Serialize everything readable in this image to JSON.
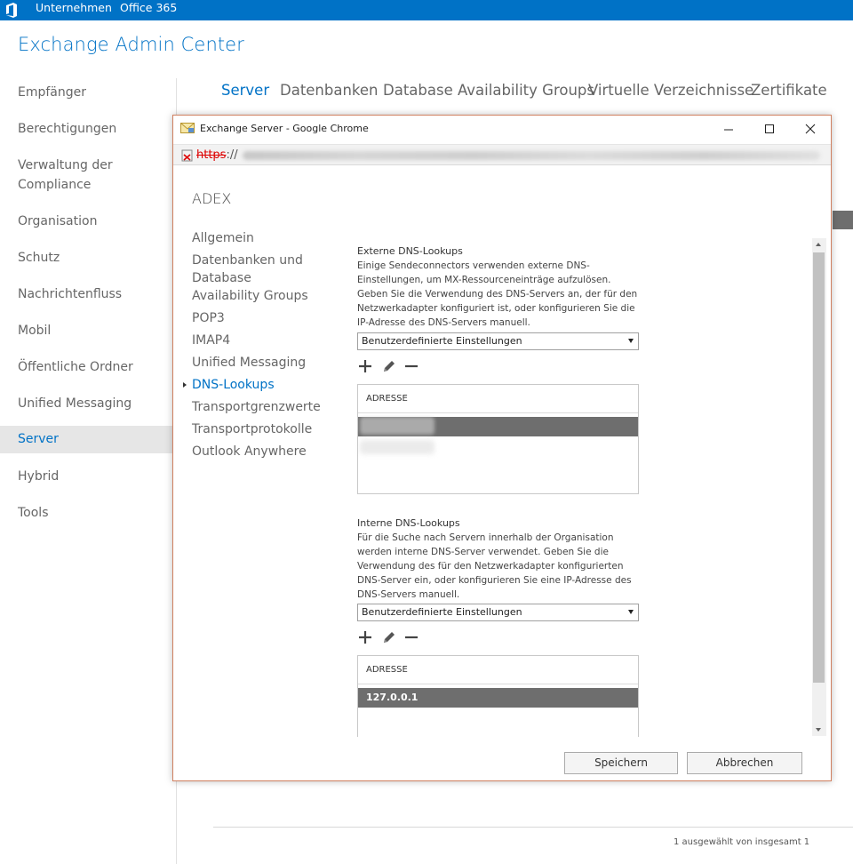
{
  "topbar": {
    "links": [
      "Unternehmen",
      "Office 365"
    ]
  },
  "app": {
    "title": "Exchange Admin Center"
  },
  "leftnav": {
    "items": [
      "Empfänger",
      "Berechtigungen",
      "Verwaltung der Compliance",
      "Organisation",
      "Schutz",
      "Nachrichtenfluss",
      "Mobil",
      "Öffentliche Ordner",
      "Unified Messaging",
      "Server",
      "Hybrid",
      "Tools"
    ],
    "selected": "Server"
  },
  "tabs": {
    "items": [
      "Server",
      "Datenbanken",
      "Database Availability Groups",
      "Virtuelle Verzeichnisse",
      "Zertifikate"
    ],
    "selected": "Server"
  },
  "status": {
    "text": "1 ausgewählt von insgesamt 1"
  },
  "popup": {
    "window_title": "Exchange Server - Google Chrome",
    "url_scheme": "https",
    "url_separator": "://",
    "heading": "ADEX",
    "nav": [
      "Allgemein",
      "Datenbanken und Database Availability Groups",
      "POP3",
      "IMAP4",
      "Unified Messaging",
      "DNS-Lookups",
      "Transportgrenzwerte",
      "Transportprotokolle",
      "Outlook Anywhere"
    ],
    "nav_selected": "DNS-Lookups",
    "external": {
      "title": "Externe DNS-Lookups",
      "description": "Einige Sendeconnectors verwenden externe DNS-Einstellungen, um MX-Ressourceneinträge aufzulösen. Geben Sie die Verwendung des DNS-Servers an, der für den Netzwerkadapter konfiguriert ist, oder konfigurieren Sie die IP-Adresse des DNS-Servers manuell.",
      "dropdown_value": "Benutzerdefinierte Einstellungen",
      "column_header": "ADRESSE"
    },
    "internal": {
      "title": "Interne DNS-Lookups",
      "description": "Für die Suche nach Servern innerhalb der Organisation werden interne DNS-Server verwendet. Geben Sie die Verwendung des für den Netzwerkadapter konfigurierten DNS-Server ein, oder konfigurieren Sie eine IP-Adresse des DNS-Servers manuell.",
      "dropdown_value": "Benutzerdefinierte Einstellungen",
      "column_header": "ADRESSE",
      "rows": [
        "127.0.0.1"
      ]
    },
    "buttons": {
      "save": "Speichern",
      "cancel": "Abbrechen"
    }
  },
  "colors": {
    "brand_blue": "#0072c6",
    "selected_row": "#6e6e6e",
    "nav_selected_bg": "#e6e6e6"
  },
  "icons": [
    "office-logo-icon",
    "envelope-icon",
    "insecure-lock-icon",
    "minimize-icon",
    "maximize-icon",
    "close-icon",
    "add-icon",
    "edit-icon",
    "remove-icon",
    "caret-right-icon",
    "chevron-down-icon"
  ]
}
